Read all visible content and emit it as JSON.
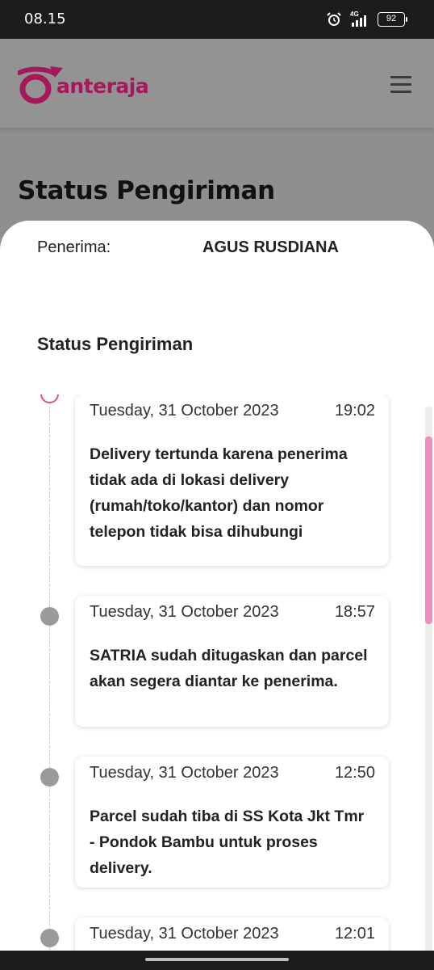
{
  "status_bar": {
    "time": "08.15",
    "network": "4G",
    "battery": "92"
  },
  "header": {
    "brand": "anteraja",
    "icons": {
      "menu": "hamburger-menu-icon",
      "logo": "anteraja-logo-icon"
    },
    "colors": {
      "brand": "#a3195b",
      "accent": "#e0488b"
    }
  },
  "page": {
    "title": "Status Pengiriman"
  },
  "sheet": {
    "recipient_label": "Penerima:",
    "recipient_name": "AGUS RUSDIANA",
    "section_title": "Status Pengiriman"
  },
  "timeline": [
    {
      "date": "Tuesday, 31 October 2023",
      "time": "19:02",
      "description": "Delivery tertunda karena penerima tidak ada di lokasi delivery (rumah/toko/kantor) dan nomor telepon tidak bisa dihubungi",
      "active": true
    },
    {
      "date": "Tuesday, 31 October 2023",
      "time": "18:57",
      "description": "SATRIA sudah ditugaskan dan parcel akan segera diantar ke penerima.",
      "active": false
    },
    {
      "date": "Tuesday, 31 October 2023",
      "time": "12:50",
      "description": "Parcel sudah tiba di SS Kota Jkt Tmr - Pondok Bambu untuk proses delivery.",
      "active": false
    },
    {
      "date": "Tuesday, 31 October 2023",
      "time": "12:01",
      "description": "",
      "active": false
    }
  ]
}
